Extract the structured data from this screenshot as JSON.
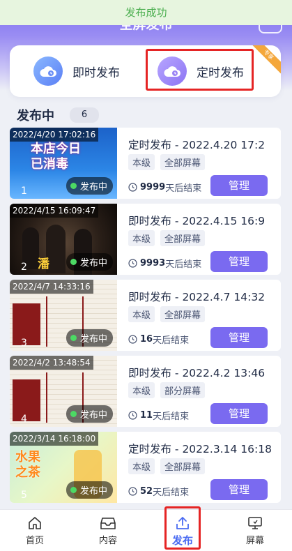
{
  "toast": "发布成功",
  "header": {
    "title": "全屏发布"
  },
  "modes": {
    "immediate_label": "即时发布",
    "scheduled_label": "定时发布",
    "corner_badge": "专享"
  },
  "section": {
    "title": "发布中",
    "count": "6"
  },
  "rows": [
    {
      "timestamp": "2022/4/20 17:02:16",
      "index": "1",
      "status": "发布中",
      "overlay": "本店今日\n已消毒",
      "title": "定时发布 - 2022.4.20 17:2",
      "tag1": "本级",
      "tag2": "全部屏幕",
      "days": "9999",
      "days_suffix": "天后结束",
      "manage": "管理"
    },
    {
      "timestamp": "2022/4/15 16:09:47",
      "index": "2",
      "status": "发布中",
      "overlay": "",
      "title": "即时发布 - 2022.4.15 16:9",
      "tag1": "本级",
      "tag2": "全部屏幕",
      "days": "9993",
      "days_suffix": "天后结束",
      "manage": "管理"
    },
    {
      "timestamp": "2022/4/7 14:33:16",
      "index": "3",
      "status": "发布中",
      "overlay": "",
      "title": "即时发布 - 2022.4.7 14:32",
      "tag1": "本级",
      "tag2": "全部屏幕",
      "days": "16",
      "days_suffix": "天后结束",
      "manage": "管理"
    },
    {
      "timestamp": "2022/4/2 13:48:54",
      "index": "4",
      "status": "发布中",
      "overlay": "",
      "title": "即时发布 - 2022.4.2 13:46",
      "tag1": "本级",
      "tag2": "部分屏幕",
      "days": "11",
      "days_suffix": "天后结束",
      "manage": "管理"
    },
    {
      "timestamp": "2022/3/14 16:18:00",
      "index": "5",
      "status": "发布中",
      "overlay": "水果\n之茶",
      "title": "定时发布 - 2022.3.14 16:18",
      "tag1": "本级",
      "tag2": "全部屏幕",
      "days": "52",
      "days_suffix": "天后结束",
      "manage": "管理"
    }
  ],
  "nav": {
    "home": "首页",
    "content": "内容",
    "publish": "发布",
    "screen": "屏幕"
  },
  "colors": {
    "accent": "#7a6af0",
    "toast_bg": "#e7f5df",
    "toast_text": "#4caf50",
    "nav_active": "#4a6bf2",
    "highlight": "#e52424"
  }
}
